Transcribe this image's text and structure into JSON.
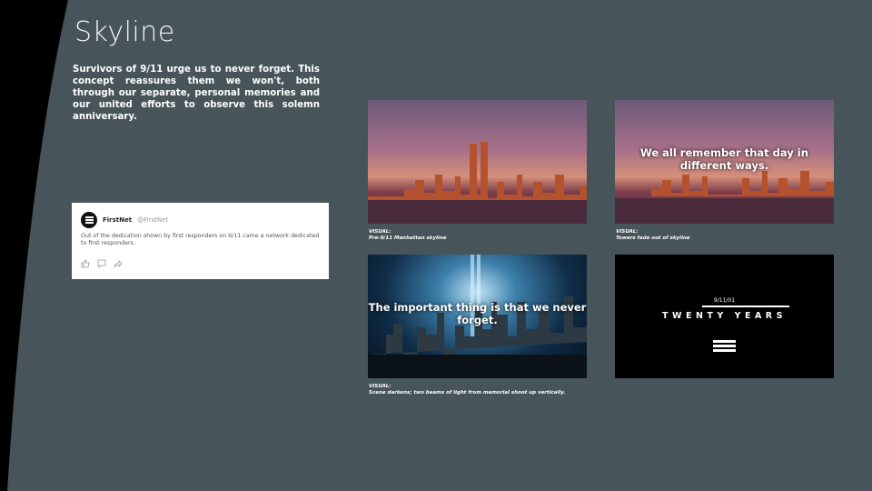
{
  "title": "Skyline",
  "intro": "Survivors of 9/11 urge us to never forget. This concept reassures them we won't, both through our separate, personal memories and our united efforts to observe this solemn anniversary.",
  "tweet": {
    "name": "FirstNet",
    "handle": "@FirstNet",
    "text": "Out of the dedication shown by first responders on 9/11 came a network dedicated to first responders.",
    "icons": [
      "like-icon",
      "comment-icon",
      "share-icon"
    ]
  },
  "frames": [
    {
      "overlay": "",
      "caption_label": "VISUAL:",
      "caption": "Pre-9/11 Manhattan skyline"
    },
    {
      "overlay": "We all remember that day in different ways.",
      "caption_label": "VISUAL:",
      "caption": "Towers fade out of skyline"
    },
    {
      "overlay": "The important thing is that we never forget.",
      "caption_label": "VISUAL:",
      "caption": "Scene darkens; two beams of light from memorial shoot up vertically."
    },
    {
      "date": "9/11/01",
      "headline": "TWENTY YEARS"
    }
  ],
  "colors": {
    "background": "#475459",
    "swoosh": "#000000"
  }
}
